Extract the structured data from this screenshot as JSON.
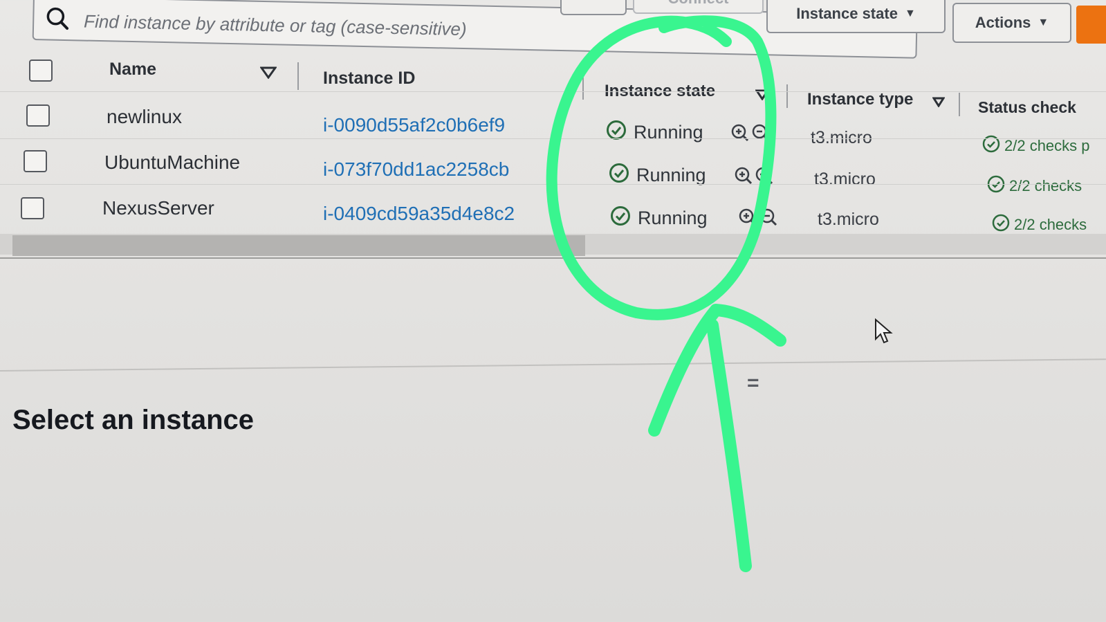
{
  "search": {
    "placeholder": "Find instance by attribute or tag (case-sensitive)"
  },
  "toolbar": {
    "connect_label": "Connect",
    "instance_state_label": "Instance state",
    "actions_label": "Actions"
  },
  "columns": {
    "name": "Name",
    "instance_id": "Instance ID",
    "instance_state": "Instance state",
    "instance_type": "Instance type",
    "status_check": "Status check"
  },
  "rows": [
    {
      "name": "newlinux",
      "id": "i-0090d55af2c0b6ef9",
      "state": "Running",
      "type": "t3.micro",
      "status": "2/2 checks p"
    },
    {
      "name": "UbuntuMachine",
      "id": "i-073f70dd1ac2258cb",
      "state": "Running",
      "type": "t3.micro",
      "status": "2/2 checks"
    },
    {
      "name": "NexusServer",
      "id": "i-0409cd59a35d4e8c2",
      "state": "Running",
      "type": "t3.micro",
      "status": "2/2 checks"
    }
  ],
  "details": {
    "title": "Select an instance",
    "handle": "="
  },
  "colors": {
    "link": "#1f6fb5",
    "running": "#2c6b3c",
    "accent_orange": "#ec7211",
    "annotation": "#39f58f"
  },
  "icons": {
    "search": "search-icon",
    "sort": "sort-caret-icon",
    "running": "check-circle-icon",
    "zoom_in": "zoom-in-icon",
    "zoom_out": "zoom-out-icon",
    "cursor": "mouse-pointer-icon"
  }
}
